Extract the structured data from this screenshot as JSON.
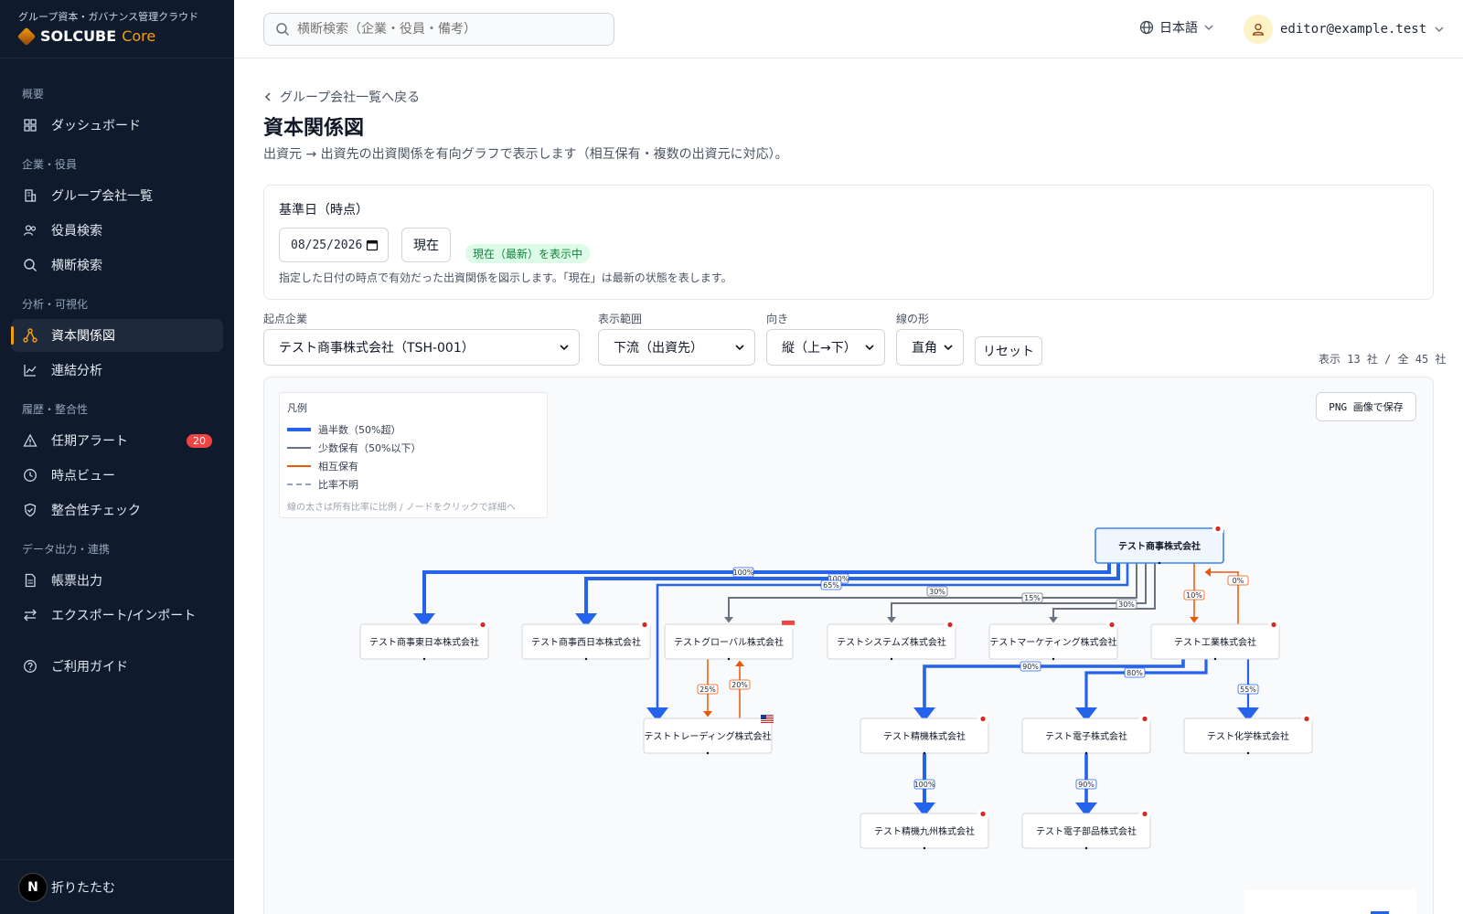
{
  "sidebar": {
    "brand_sub": "グループ資本・ガバナンス管理クラウド",
    "brand_main": "SOLCUBE",
    "brand_core": "Core",
    "sections": [
      {
        "title": "概要",
        "items": [
          {
            "label": "ダッシュボード",
            "icon": "grid-icon"
          }
        ]
      },
      {
        "title": "企業・役員",
        "items": [
          {
            "label": "グループ会社一覧",
            "icon": "building-icon"
          },
          {
            "label": "役員検索",
            "icon": "users-icon"
          },
          {
            "label": "横断検索",
            "icon": "search-icon"
          }
        ]
      },
      {
        "title": "分析・可視化",
        "items": [
          {
            "label": "資本関係図",
            "icon": "network-icon",
            "active": true
          },
          {
            "label": "連結分析",
            "icon": "chart-line-icon"
          }
        ]
      },
      {
        "title": "履歴・整合性",
        "items": [
          {
            "label": "任期アラート",
            "icon": "alert-icon",
            "badge": "20"
          },
          {
            "label": "時点ビュー",
            "icon": "clock-icon"
          },
          {
            "label": "整合性チェック",
            "icon": "shield-check-icon"
          }
        ]
      },
      {
        "title": "データ出力・連携",
        "items": [
          {
            "label": "帳票出力",
            "icon": "document-icon"
          },
          {
            "label": "エクスポート/インポート",
            "icon": "swap-icon"
          }
        ]
      },
      {
        "title": "",
        "items": [
          {
            "label": "ご利用ガイド",
            "icon": "help-icon"
          }
        ]
      }
    ],
    "collapse_label": "折りたたむ",
    "avatar_letter": "N"
  },
  "topbar": {
    "search_placeholder": "横断検索（企業・役員・備考）",
    "language": "日本語",
    "user_email": "editor@example.test"
  },
  "page": {
    "back_link": "グループ会社一覧へ戻る",
    "title": "資本関係図",
    "description": "出資元 → 出資先の出資関係を有向グラフで表示します（相互保有・複数の出資元に対応）。"
  },
  "date_filter": {
    "label": "基準日（時点）",
    "date_value": "08/25/2026",
    "now_button": "現在",
    "status": "現在（最新）を表示中",
    "hint": "指定した日付の時点で有効だった出資関係を図示します。「現在」は最新の状態を表します。"
  },
  "controls": {
    "origin_label": "起点企業",
    "origin_value": "テスト商事株式会社（TSH-001）",
    "scope_label": "表示範囲",
    "scope_value": "下流（出資先）",
    "direction_label": "向き",
    "direction_value": "縦（上→下）",
    "line_label": "線の形",
    "line_value": "直角",
    "reset_button": "リセット",
    "count_text": "表示 13 社 / 全 45 社"
  },
  "graph": {
    "png_button": "PNG 画像で保存",
    "legend": {
      "title": "凡例",
      "items": [
        {
          "label": "過半数（50%超）",
          "color": "#2563eb",
          "style": "solid-thick"
        },
        {
          "label": "少数保有（50%以下）",
          "color": "#64748b",
          "style": "solid"
        },
        {
          "label": "相互保有",
          "color": "#ea580c",
          "style": "solid"
        },
        {
          "label": "比率不明",
          "color": "#94a3b8",
          "style": "dashed"
        }
      ],
      "note": "線の太さは所有比率に比例 / ノードをクリックで詳細へ"
    },
    "colors": {
      "majority": "#2563eb",
      "minority": "#6b7280",
      "mutual": "#ea580c",
      "root_fill": "#eff6ff",
      "root_border": "#3b82f6"
    },
    "nodes": [
      {
        "id": "root",
        "label": "テスト商事株式会社",
        "flag": "jp",
        "root": true
      },
      {
        "id": "east",
        "label": "テスト商事東日本株式会社",
        "flag": "jp"
      },
      {
        "id": "west",
        "label": "テスト商事西日本株式会社",
        "flag": "jp"
      },
      {
        "id": "global",
        "label": "テストグローバル株式会社",
        "flag": "sg"
      },
      {
        "id": "systems",
        "label": "テストシステムズ株式会社",
        "flag": "jp"
      },
      {
        "id": "marketing",
        "label": "テストマーケティング株式会社",
        "flag": "jp"
      },
      {
        "id": "industry",
        "label": "テスト工業株式会社",
        "flag": "jp"
      },
      {
        "id": "trading",
        "label": "テストトレーディング株式会社",
        "flag": "us"
      },
      {
        "id": "seiki",
        "label": "テスト精機株式会社",
        "flag": "jp"
      },
      {
        "id": "denshi",
        "label": "テスト電子株式会社",
        "flag": "jp"
      },
      {
        "id": "kagaku",
        "label": "テスト化学株式会社",
        "flag": "jp"
      },
      {
        "id": "seiki_kyushu",
        "label": "テスト精機九州株式会社",
        "flag": "jp"
      },
      {
        "id": "denshi_buhin",
        "label": "テスト電子部品株式会社",
        "flag": "jp"
      }
    ],
    "edges": [
      {
        "from": "root",
        "to": "east",
        "pct": "100%",
        "kind": "majority"
      },
      {
        "from": "root",
        "to": "west",
        "pct": "100%",
        "kind": "majority"
      },
      {
        "from": "root",
        "to": "trading",
        "pct": "65%",
        "kind": "majority"
      },
      {
        "from": "root",
        "to": "global",
        "pct": "30%",
        "kind": "minority"
      },
      {
        "from": "root",
        "to": "systems",
        "pct": "15%",
        "kind": "minority"
      },
      {
        "from": "root",
        "to": "marketing",
        "pct": "30%",
        "kind": "minority"
      },
      {
        "from": "root",
        "to": "industry",
        "pct": "10%",
        "kind": "mutual"
      },
      {
        "from": "industry",
        "to": "root",
        "pct": "0%",
        "kind": "mutual"
      },
      {
        "from": "global",
        "to": "trading",
        "pct": "25%",
        "kind": "mutual"
      },
      {
        "from": "trading",
        "to": "global",
        "pct": "20%",
        "kind": "mutual"
      },
      {
        "from": "industry",
        "to": "seiki",
        "pct": "90%",
        "kind": "majority"
      },
      {
        "from": "industry",
        "to": "denshi",
        "pct": "80%",
        "kind": "majority"
      },
      {
        "from": "industry",
        "to": "kagaku",
        "pct": "55%",
        "kind": "majority"
      },
      {
        "from": "seiki",
        "to": "seiki_kyushu",
        "pct": "100%",
        "kind": "majority"
      },
      {
        "from": "denshi",
        "to": "denshi_buhin",
        "pct": "90%",
        "kind": "majority"
      }
    ]
  }
}
